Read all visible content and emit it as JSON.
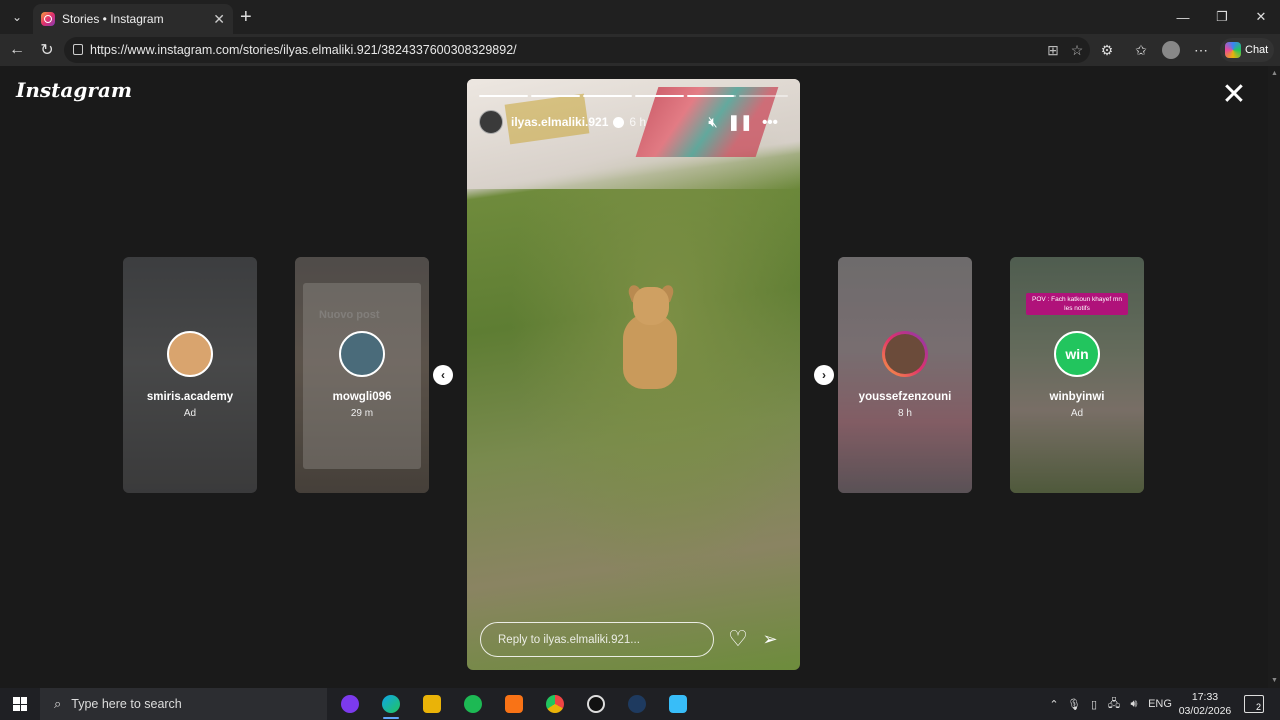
{
  "browser": {
    "tab_title": "Stories • Instagram",
    "new_tab_icon": "plus-icon",
    "url": "https://www.instagram.com/stories/ilyas.elmaliki.921/3824337600308329892/",
    "chat_label": "Chat"
  },
  "page": {
    "logo": "Instagram",
    "close_icon": "close-icon"
  },
  "side_stories": [
    {
      "username": "smiris.academy",
      "sub": "Ad"
    },
    {
      "username": "mowgli096",
      "sub": "29 m",
      "ghost_text": "Nuovo post"
    },
    {
      "username": "youssefzenzouni",
      "sub": "8 h"
    },
    {
      "username": "winbyinwi",
      "sub": "Ad",
      "overlay_text": "POV : Fach katkoun khayef mn les notifs",
      "avatar_text": "win"
    }
  ],
  "story": {
    "username": "ilyas.elmaliki.921",
    "time": "6 h",
    "reply_placeholder": "Reply to ilyas.elmaliki.921...",
    "progress": [
      1,
      1,
      1,
      1,
      0.95,
      0
    ],
    "muted": true,
    "paused": true
  },
  "taskbar": {
    "search_placeholder": "Type here to search",
    "language": "ENG",
    "time": "17:33",
    "date": "03/02/2026",
    "notification_count": "2"
  },
  "colors": {
    "background": "#1a1a1a",
    "instagram_gradient": [
      "#f9a03f",
      "#e1306c",
      "#833ab4"
    ]
  }
}
